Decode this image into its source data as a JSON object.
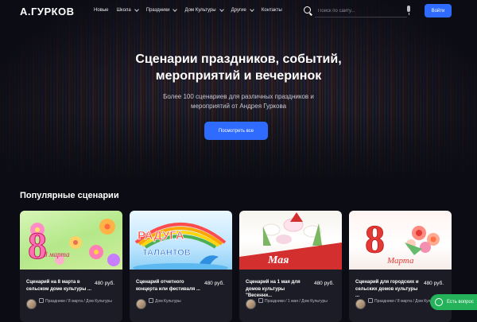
{
  "header": {
    "logo": "А.ГУРКОВ",
    "nav": [
      {
        "label": "Новые",
        "dropdown": false
      },
      {
        "label": "Школа",
        "dropdown": true
      },
      {
        "label": "Праздники",
        "dropdown": true
      },
      {
        "label": "Дом Культуры",
        "dropdown": true
      },
      {
        "label": "Другие",
        "dropdown": true
      },
      {
        "label": "Контакты",
        "dropdown": false
      }
    ],
    "search_placeholder": "Поиск по сайту...",
    "login_label": "Войти"
  },
  "hero": {
    "title_line1": "Сценарии праздников, событий,",
    "title_line2": "мероприятий и вечеринок",
    "subtitle_line1": "Более 100 сценариев для различных праздников и",
    "subtitle_line2": "мероприятий от Андрея Гуркова",
    "button_label": "Посмотреть все"
  },
  "popular": {
    "title": "Популярные сценарии",
    "cards": [
      {
        "title": "Сценарий на 8 марта в сельском доме культуры ...",
        "price": "480 руб.",
        "meta": "Праздники / 8 марта / Дом Культуры",
        "image": "8 марта"
      },
      {
        "title": "Сценарий отчетного концерта или фестиваля ...",
        "price": "480 руб.",
        "meta": "Дом Культуры",
        "image": "РАДУГА ТАЛАНТОВ"
      },
      {
        "title": "Сценарий на 1 мая для домов культуры \"Весенни...",
        "price": "480 руб.",
        "meta": "Праздники / 1 мая / Дом Культуры",
        "image": "1 Мая"
      },
      {
        "title": "Сценарий для городских и сельских домов культуры ...",
        "price": "480 руб.",
        "meta": "Праздники / 8 марта / Дом Культуры",
        "image": "8 марта"
      }
    ]
  },
  "chat": {
    "label": "Есть вопрос"
  },
  "colors": {
    "accent": "#2f6bff",
    "background": "#0c0c14",
    "card": "#1c1c26",
    "chat": "#24b35a"
  }
}
